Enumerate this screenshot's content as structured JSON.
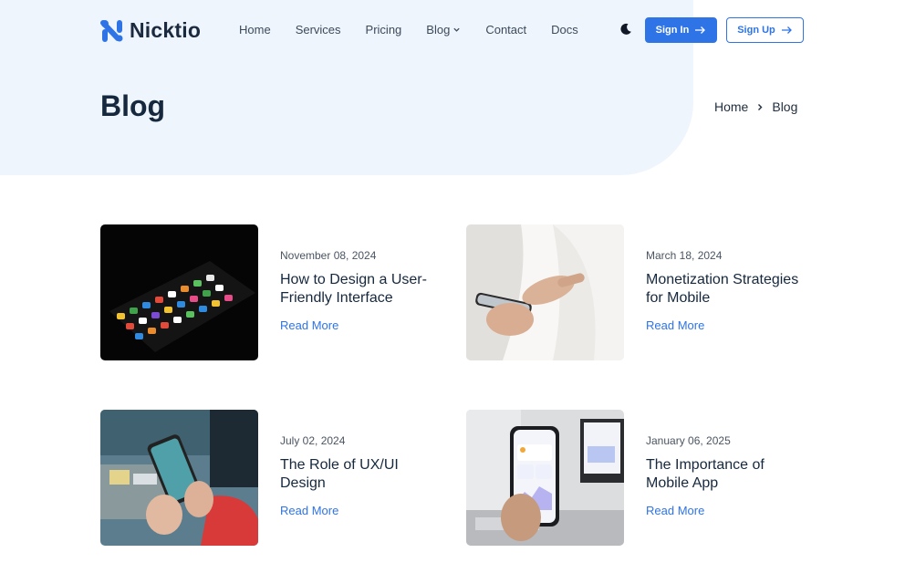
{
  "brand": {
    "name": "Nicktio",
    "accent": "#2e74e6",
    "logo_icon": "logo-mark-icon"
  },
  "nav": {
    "items": [
      {
        "label": "Home"
      },
      {
        "label": "Services"
      },
      {
        "label": "Pricing"
      },
      {
        "label": "Blog",
        "has_dropdown": true
      },
      {
        "label": "Contact"
      },
      {
        "label": "Docs"
      }
    ],
    "theme_toggle_icon": "moon-icon",
    "signin_label": "Sign In",
    "signup_label": "Sign Up"
  },
  "page": {
    "title": "Blog",
    "breadcrumb": {
      "home": "Home",
      "current": "Blog"
    }
  },
  "posts": [
    {
      "date": "November 08, 2024",
      "title": "How to Design a User-Friendly Interface",
      "link": "Read More",
      "image": "phone-apps-dark-image"
    },
    {
      "date": "March 18, 2024",
      "title": "Monetization Strategies for Mobile",
      "link": "Read More",
      "image": "hand-holding-phone-image"
    },
    {
      "date": "July 02, 2024",
      "title": "The Role of UX/UI Design",
      "link": "Read More",
      "image": "phone-desk-image"
    },
    {
      "date": "January 06, 2025",
      "title": "The Importance of Mobile App",
      "link": "Read More",
      "image": "phone-analytics-image"
    }
  ]
}
